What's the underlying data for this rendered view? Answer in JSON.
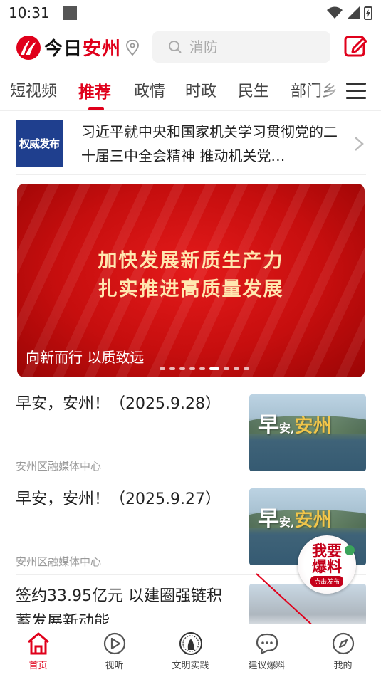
{
  "status_bar": {
    "time": "10:31"
  },
  "header": {
    "logo_text_a": "今日",
    "logo_text_b": "安州",
    "search_placeholder": "消防"
  },
  "tabs": [
    "短视频",
    "推荐",
    "政情",
    "时政",
    "民生",
    "部门乡"
  ],
  "active_tab": "推荐",
  "notice": {
    "badge": "权威发布",
    "text": "习近平就中央和国家机关学习贯彻党的二十届三中全会精神 推动机关党…"
  },
  "banner": {
    "line1": "加快发展新质生产力",
    "line2": "扎实推进高质量发展",
    "caption": "向新而行 以质致远",
    "dots": 9,
    "active_dot": 5
  },
  "news": [
    {
      "title": "早安，安州！（2025.9.28）",
      "source": "安州区融媒体中心",
      "thumb_text_a": "早",
      "thumb_text_b": "安,",
      "thumb_text_c": "安州"
    },
    {
      "title": "早安，安州！（2025.9.27）",
      "source": "安州区融媒体中心",
      "thumb_text_a": "早",
      "thumb_text_b": "安,",
      "thumb_text_c": "安州"
    },
    {
      "title": "签约33.95亿元 以建圈强链积蓄发展新动能",
      "source": ""
    }
  ],
  "floating_badge": {
    "line1": "我要",
    "line2": "爆料",
    "tag": "点击发布"
  },
  "bottom_nav": [
    {
      "label": "首页",
      "icon": "home-icon"
    },
    {
      "label": "视听",
      "icon": "play-icon"
    },
    {
      "label": "文明实践",
      "icon": "emblem-icon"
    },
    {
      "label": "建议爆料",
      "icon": "chat-icon"
    },
    {
      "label": "我的",
      "icon": "compass-icon"
    }
  ],
  "colors": {
    "brand_red": "#e0001b",
    "badge_blue": "#1f3f8e"
  }
}
